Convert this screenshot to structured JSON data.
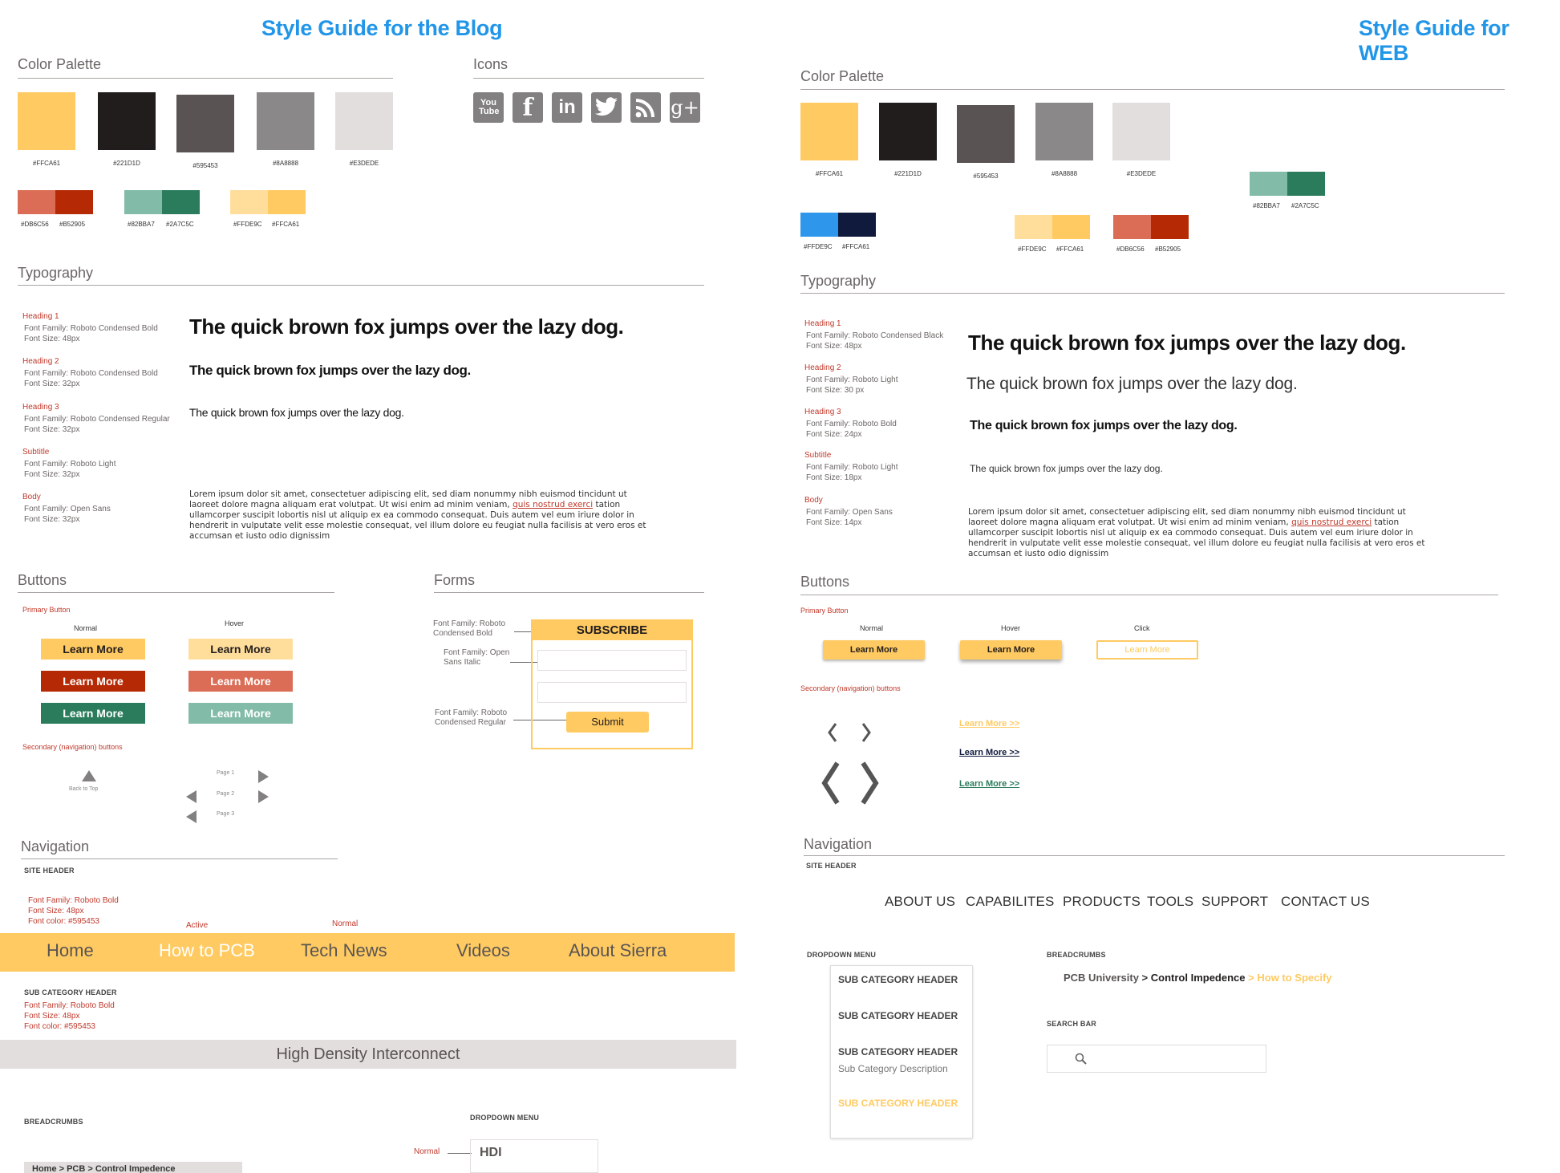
{
  "blog": {
    "title": "Style Guide for the Blog",
    "sections": {
      "palette": "Color Palette",
      "icons": "Icons",
      "typography": "Typography",
      "buttons": "Buttons",
      "forms": "Forms",
      "navigation": "Navigation"
    },
    "swatches": [
      {
        "hex": "#FFCA61",
        "label": "#FFCA61"
      },
      {
        "hex": "#221D1D",
        "label": "#221D1D"
      },
      {
        "hex": "#595453",
        "label": "#595453"
      },
      {
        "hex": "#8A8888",
        "label": "#8A8888"
      },
      {
        "hex": "#E3DEDE",
        "label": "#E3DEDE"
      }
    ],
    "pairs": [
      {
        "a": "#DB6C56",
        "b": "#B52905",
        "la": "#DB6C56",
        "lb": "#B52905"
      },
      {
        "a": "#82BBA7",
        "b": "#2A7C5C",
        "la": "#82BBA7",
        "lb": "#2A7C5C"
      },
      {
        "a": "#FFDE9C",
        "b": "#FFCA61",
        "la": "#FFDE9C",
        "lb": "#FFCA61"
      }
    ],
    "icons": [
      "You Tube",
      "f",
      "in",
      "t",
      "rss",
      "g+"
    ],
    "typography": [
      {
        "name": "Heading 1",
        "family": "Font Family:  Roboto Condensed Bold",
        "size": "Font Size:  48px",
        "sample": "The quick brown fox jumps over the lazy dog."
      },
      {
        "name": "Heading 2",
        "family": "Font Family:  Roboto Condensed Bold",
        "size": "Font Size:  32px",
        "sample": "The quick brown fox jumps over the lazy dog."
      },
      {
        "name": "Heading 3",
        "family": "Font Family:  Roboto Condensed Regular",
        "size": "Font Size:  32px",
        "sample": "The quick brown fox jumps over the lazy dog."
      },
      {
        "name": "Subtitle",
        "family": "Font Family:  Roboto Light",
        "size": "Font Size:  32px"
      },
      {
        "name": "Body",
        "family": "Font Family:  Open Sans",
        "size": "Font Size:  32px"
      }
    ],
    "lorem": {
      "before": "Lorem ipsum dolor sit amet, consectetuer adipiscing elit, sed diam nonummy nibh euismod tincidunt ut laoreet dolore magna aliquam erat volutpat. Ut wisi enim ad minim veniam, ",
      "link": "quis nostrud exerci",
      "after": " tation ullamcorper suscipit lobortis nisl ut aliquip ex ea commodo consequat. Duis autem vel eum iriure dolor in hendrerit in vulputate velit esse molestie consequat, vel illum dolore eu feugiat nulla facilisis at vero eros et accumsan et iusto odio dignissim"
    },
    "buttons": {
      "primary": "Primary Button",
      "normal": "Normal",
      "hover": "Hover",
      "label": "Learn More",
      "secondary": "Secondary (navigation) buttons",
      "back_to_top": "Back to Top",
      "page1": "Page 1",
      "page2": "Page 2",
      "page3": "Page 3"
    },
    "forms": {
      "note1": "Font Family:  Roboto Condensed Bold",
      "note2": "Font Family:  Open Sans Italic",
      "note3": "Font Family:  Roboto Condensed Regular",
      "subscribe": "SUBSCRIBE",
      "submit": "Submit"
    },
    "nav": {
      "site_header": "SITE HEADER",
      "spec": [
        "Font Family:  Roboto Bold",
        "Font Size:  48px",
        "Font color: #595453"
      ],
      "active": "Active",
      "normal": "Normal",
      "items": [
        "Home",
        "How to PCB",
        "Tech News",
        "Videos",
        "About Sierra"
      ],
      "sub_header": "SUB CATEGORY HEADER",
      "sub_spec": [
        "Font Family:  Roboto Bold",
        "Font Size:  48px",
        "Font color: #595453"
      ],
      "banner": "High Density Interconnect",
      "breadcrumbs": "BREADCRUMBS",
      "dropdown": "DROPDOWN MENU",
      "dd_normal": "Normal",
      "dd_item": "HDI",
      "crumb_partial": "Home  >  PCB  >  Control Impedence"
    }
  },
  "web": {
    "title": "Style Guide for WEB",
    "sections": {
      "palette": "Color Palette",
      "typography": "Typography",
      "buttons": "Buttons",
      "navigation": "Navigation"
    },
    "swatches": [
      {
        "hex": "#FFCA61",
        "label": "#FFCA61"
      },
      {
        "hex": "#221D1D",
        "label": "#221D1D"
      },
      {
        "hex": "#595453",
        "label": "#595453"
      },
      {
        "hex": "#8A8888",
        "label": "#8A8888"
      },
      {
        "hex": "#E3DEDE",
        "label": "#E3DEDE"
      }
    ],
    "pairs": [
      {
        "a": "#82BBA7",
        "b": "#2A7C5C",
        "la": "#82BBA7",
        "lb": "#2A7C5C"
      },
      {
        "a": "#2E97EB",
        "b": "#0F1A3D",
        "la": "#FFDE9C",
        "lb": "#FFCA61"
      },
      {
        "a": "#FFDE9C",
        "b": "#FFCA61",
        "la": "#FFDE9C",
        "lb": "#FFCA61"
      },
      {
        "a": "#DB6C56",
        "b": "#B52905",
        "la": "#DB6C56",
        "lb": "#B52905"
      }
    ],
    "typography": [
      {
        "name": "Heading 1",
        "family": "Font Family:  Roboto Condensed Black",
        "size": "Font Size:  48px",
        "sample": "The quick brown fox jumps over the lazy dog."
      },
      {
        "name": "Heading 2",
        "family": "Font Family:  Roboto Light",
        "size": "Font Size:  30 px",
        "sample": "The quick brown fox jumps over the lazy dog."
      },
      {
        "name": "Heading 3",
        "family": "Font Family:  Roboto Bold",
        "size": "Font Size:  24px",
        "sample": "The quick brown fox jumps over the lazy dog."
      },
      {
        "name": "Subtitle",
        "family": "Font Family:  Roboto Light",
        "size": "Font Size:  18px",
        "sample": "The quick brown fox jumps over the lazy dog."
      },
      {
        "name": "Body",
        "family": "Font Family:  Open Sans",
        "size": "Font Size:  14px"
      }
    ],
    "buttons": {
      "primary": "Primary Button",
      "normal": "Normal",
      "hover": "Hover",
      "click": "Click",
      "label": "Learn More",
      "secondary": "Secondary (navigation) buttons",
      "link": "Learn More >>"
    },
    "nav": {
      "site_header": "SITE HEADER",
      "items": [
        "ABOUT US",
        "CAPABILITES",
        "PRODUCTS",
        "TOOLS",
        "SUPPORT",
        "CONTACT US"
      ],
      "dropdown": "DROPDOWN MENU",
      "dd": [
        "SUB CATEGORY HEADER",
        "SUB CATEGORY HEADER",
        "SUB CATEGORY HEADER",
        "Sub Category Description",
        "SUB CATEGORY HEADER"
      ],
      "breadcrumbs": "BREADCRUMBS",
      "crumb1": "PCB University",
      "crumb2": "Control Impedence",
      "crumb3": "How to Specify",
      "sep": ">",
      "search": "SEARCH BAR"
    }
  }
}
